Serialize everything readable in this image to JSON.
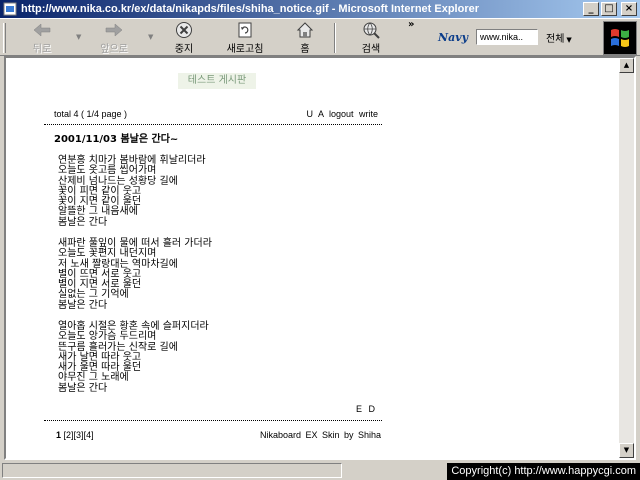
{
  "window": {
    "title": "http://www.nika.co.kr/ex/data/nikapds/files/shiha_notice.gif - Microsoft Internet Explorer",
    "minimize": "_",
    "maximize": "□",
    "close": "×"
  },
  "toolbar": {
    "back": "뒤로",
    "forward": "앞으로",
    "stop": "중지",
    "refresh": "새로고침",
    "home": "홈",
    "search": "검색",
    "more": "»",
    "navy_logo": "Navy",
    "navy_input": "www.nika..",
    "navy_select": "전체"
  },
  "board": {
    "title": "테스트 게시판",
    "total": "total 4 ( 1/4 page )",
    "actions": "U A logout write",
    "post_title": "2001/11/03  봄날은 간다~",
    "stanza1": [
      "연분홍 치마가 봄바람에 휘날리더라",
      "오늘도 옷고름 씹어가며",
      "산제비 넘나드는 성황당 길에",
      "꽃이 피면 같이 웃고",
      "꽃이 지면 같이 울던",
      "알뜰한 그 내음새에",
      "봄날은 간다"
    ],
    "stanza2": [
      "새파란 풀잎이 물에 떠서 흘러 가더라",
      "오늘도 꽃편지 내던지며",
      "저 노새 짤랑대는 역마차길에",
      "별이 뜨면 서로 웃고",
      "별이 지면 서로 울던",
      "실없는 그 기억에",
      "봄날은 간다"
    ],
    "stanza3": [
      "열아홉 시절은 황혼 속에 슬퍼지더라",
      "오늘도 앙가슴 두드리며",
      "뜬구름 흘러가는 신작로 길에",
      "새가 날면 따라 웃고",
      "새가 울면 따라 울던",
      "야무진 그 노래에",
      "봄날은 간다"
    ],
    "post_actions": "E D",
    "pages": [
      "1",
      "[2]",
      "[3]",
      "[4]"
    ],
    "credit": "Nikaboard EX   Skin by Shiha"
  },
  "status": {
    "copyright": "Copyright(c) http://www.happycgi.com"
  }
}
